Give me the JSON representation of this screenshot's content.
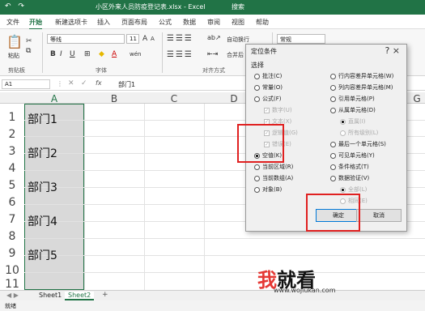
{
  "window": {
    "title": "小区外来人员防疫登记表.xlsx  -  Excel",
    "search": "搜索",
    "qat": "↶ ↷"
  },
  "menu": [
    "文件",
    "开始",
    "新建选项卡",
    "插入",
    "页面布局",
    "公式",
    "数据",
    "审阅",
    "视图",
    "帮助"
  ],
  "ribbon": {
    "paste_label": "粘贴",
    "clipboard_label": "剪贴板",
    "font_name": "等线",
    "font_size": "11",
    "bold": "B",
    "italic": "I",
    "underline": "U",
    "font_group_label": "字体",
    "wrap_text": "自动换行",
    "merge": "合并后",
    "align_group_label": "对齐方式",
    "number_format": "常规",
    "grow_font": "A",
    "shrink_font": "A",
    "wen": "wén",
    "font_color_a": "A"
  },
  "formula_bar": {
    "name_box": "A1",
    "fx": "fx",
    "content": "部门1"
  },
  "columns": [
    "A",
    "B",
    "C",
    "D",
    "G"
  ],
  "rows": [
    "1",
    "2",
    "3",
    "4",
    "5",
    "6",
    "7",
    "8",
    "9",
    "10",
    "11"
  ],
  "cells": [
    "部门1",
    "部门2",
    "部门3",
    "部门4",
    "部门5"
  ],
  "sheets": [
    "Sheet1",
    "Sheet2"
  ],
  "add_sheet": "+",
  "status": "就绪",
  "dialog": {
    "title": "定位条件",
    "close": "?   ×",
    "section": "选择",
    "left_options": [
      {
        "label": "批注(C)",
        "type": "radio",
        "state": "off"
      },
      {
        "label": "常量(O)",
        "type": "radio",
        "state": "off"
      },
      {
        "label": "公式(F)",
        "type": "radio",
        "state": "off"
      },
      {
        "label": "数字(U)",
        "type": "check",
        "state": "dim"
      },
      {
        "label": "文本(X)",
        "type": "check",
        "state": "dim"
      },
      {
        "label": "逻辑值(G)",
        "type": "check",
        "state": "dim"
      },
      {
        "label": "错误(E)",
        "type": "check",
        "state": "dim"
      },
      {
        "label": "空值(K)",
        "type": "radio",
        "state": "on"
      },
      {
        "label": "当前区域(R)",
        "type": "radio",
        "state": "off"
      },
      {
        "label": "当前数组(A)",
        "type": "radio",
        "state": "off"
      },
      {
        "label": "对象(B)",
        "type": "radio",
        "state": "off"
      }
    ],
    "right_options": [
      {
        "label": "行内容差异单元格(W)",
        "type": "radio",
        "state": "off"
      },
      {
        "label": "列内容差异单元格(M)",
        "type": "radio",
        "state": "off"
      },
      {
        "label": "引用单元格(P)",
        "type": "radio",
        "state": "off"
      },
      {
        "label": "从属单元格(D)",
        "type": "radio",
        "state": "off"
      },
      {
        "label": "直属(I)",
        "type": "radio",
        "state": "dim"
      },
      {
        "label": "所有级别(L)",
        "type": "radio",
        "state": "dim"
      },
      {
        "label": "最后一个单元格(S)",
        "type": "radio",
        "state": "off"
      },
      {
        "label": "可见单元格(Y)",
        "type": "radio",
        "state": "off"
      },
      {
        "label": "条件格式(T)",
        "type": "radio",
        "state": "off"
      },
      {
        "label": "数据验证(V)",
        "type": "radio",
        "state": "off"
      },
      {
        "label": "全部(L)",
        "type": "radio",
        "state": "dim"
      },
      {
        "label": "相同(E)",
        "type": "radio",
        "state": "dim"
      }
    ],
    "ok": "确定",
    "cancel": "取消"
  },
  "watermark": {
    "logo_first": "我",
    "logo_rest": "就看",
    "url": "www.wojiukan.com"
  },
  "colors": {
    "excel_green": "#217346",
    "highlight_red": "#e02020"
  }
}
